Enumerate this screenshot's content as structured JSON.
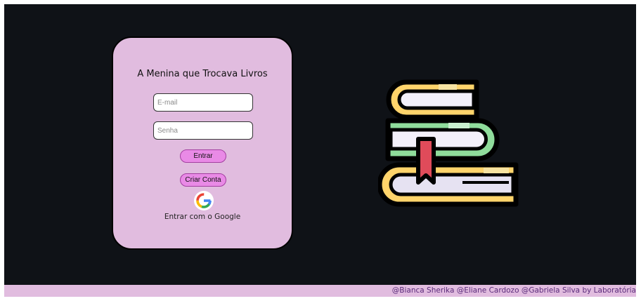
{
  "login": {
    "title": "A Menina que Trocava Livros",
    "email_placeholder": "E-mail",
    "password_placeholder": "Senha",
    "login_button": "Entrar",
    "create_account_button": "Criar Conta",
    "google_label": "Entrar com o Google",
    "google_icon": "google-g-logo"
  },
  "illustration": {
    "icon": "stack-of-books"
  },
  "footer": {
    "credits": "@Bianca Sherika @Eliane Cardozo @Gabriela Silva by Laboratória"
  },
  "colors": {
    "background": "#0f1217",
    "card": "#e1bcdf",
    "button": "#e98ae6",
    "footer": "#e1bcdf",
    "credits_text": "#5a2a7a"
  }
}
